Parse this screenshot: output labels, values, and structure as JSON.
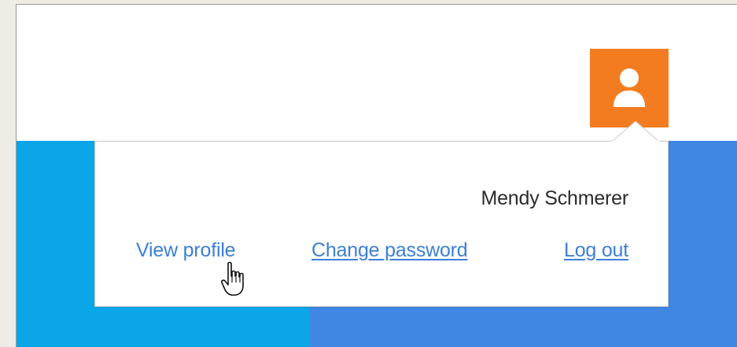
{
  "user_menu": {
    "user_name": "Mendy Schmerer",
    "links": {
      "view_profile": "View profile",
      "change_password": "Change password",
      "log_out": "Log out"
    }
  },
  "colors": {
    "avatar_button": "#f47c20",
    "band_left": "#0aa6e8",
    "band_right": "#3f87e2",
    "link": "#3c7fd8"
  },
  "icons": {
    "avatar": "user-icon",
    "cursor": "hand-pointer-icon"
  }
}
